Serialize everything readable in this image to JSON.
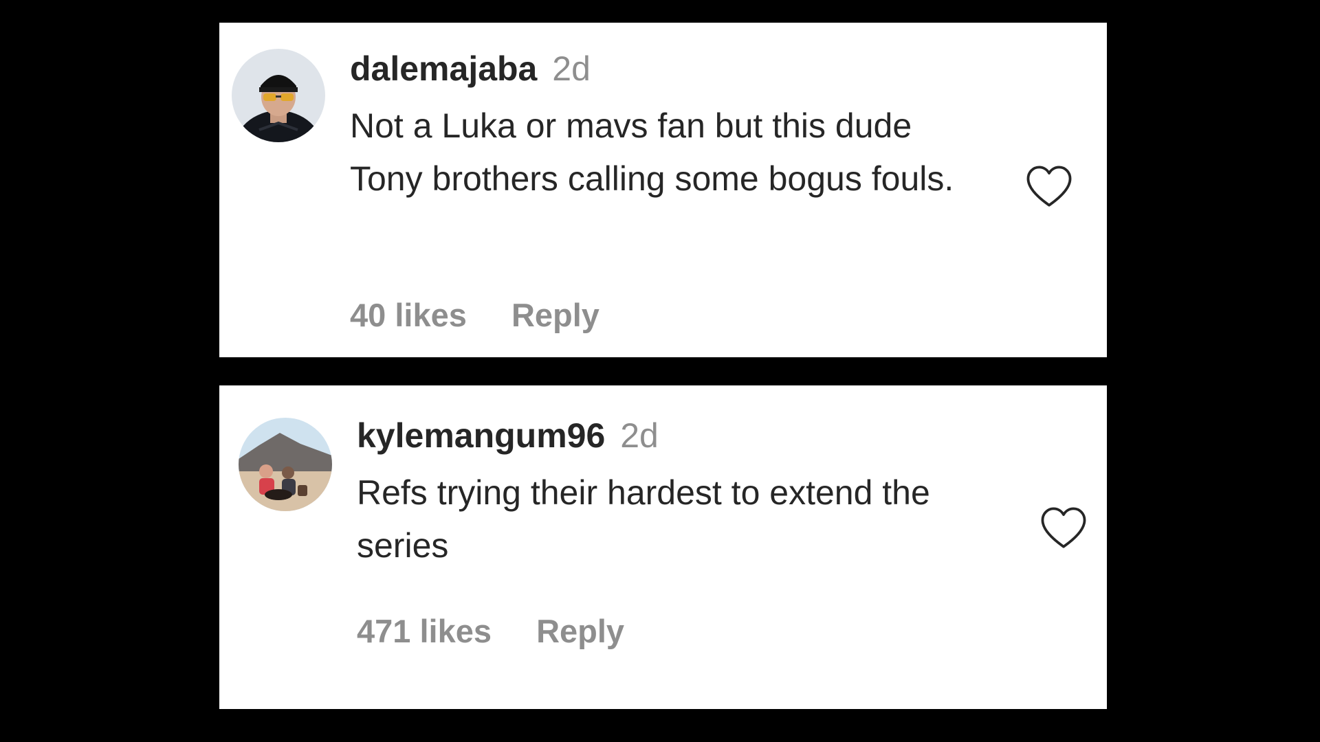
{
  "comments": [
    {
      "username": "dalemajaba",
      "time": "2d",
      "text": "Not a Luka or mavs fan but this dude Tony brothers calling some bogus fouls.",
      "likes": "40 likes",
      "reply": "Reply",
      "avatar": "user-avatar-man-in-cap",
      "like_icon": "heart-outline-icon"
    },
    {
      "username": "kylemangum96",
      "time": "2d",
      "text": "Refs trying their hardest to extend the series",
      "likes": "471 likes",
      "reply": "Reply",
      "avatar": "user-avatar-beach-photo",
      "like_icon": "heart-outline-icon"
    }
  ],
  "colors": {
    "background": "#000000",
    "card": "#ffffff",
    "primary_text": "#262626",
    "secondary_text": "#8e8e8e"
  }
}
